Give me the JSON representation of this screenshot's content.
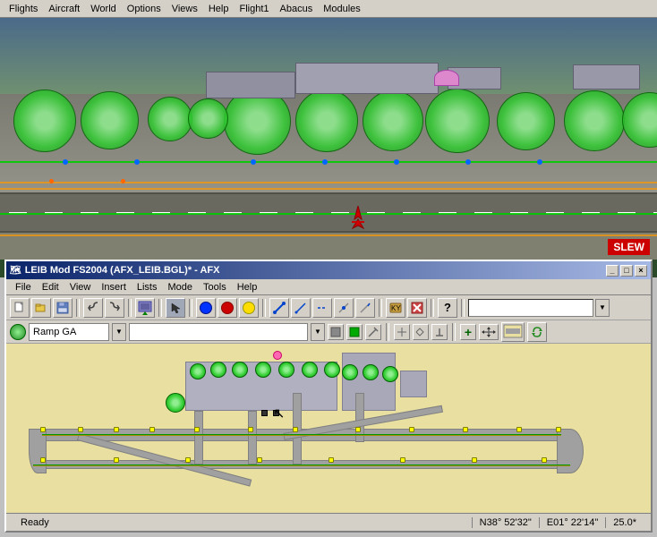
{
  "top_menu": {
    "items": [
      "Flights",
      "Aircraft",
      "World",
      "Options",
      "Views",
      "Help",
      "Flight1",
      "Abacus",
      "Modules"
    ]
  },
  "slew_badge": "SLEW",
  "afx_window": {
    "title": "LEIB Mod FS2004 (AFX_LEIB.BGL)* - AFX",
    "title_buttons": [
      "_",
      "□",
      "×"
    ],
    "menu_items": [
      "File",
      "Edit",
      "View",
      "Insert",
      "Lists",
      "Mode",
      "Tools",
      "Help"
    ],
    "toolbar1": {
      "buttons": [
        "new",
        "open",
        "save",
        "separator",
        "undo",
        "redo",
        "separator",
        "import",
        "separator",
        "cursor",
        "separator",
        "dot_blue",
        "dot_red",
        "dot_yellow",
        "separator",
        "line1",
        "line2",
        "line3",
        "line4",
        "line5",
        "separator",
        "key_icon",
        "x_icon",
        "separator",
        "help"
      ]
    },
    "toolbar2": {
      "indicator": "green",
      "dropdown1": "Ramp GA",
      "dropdown2": "",
      "buttons": [
        "square_gray",
        "square_green",
        "toolbar_icon1",
        "separator",
        "draw_btns",
        "plus",
        "cross_arrow"
      ]
    }
  },
  "status_bar": {
    "ready": "Ready",
    "coords1": "N38° 52'32\"",
    "coords2": "E01° 22'14\"",
    "zoom": "25.0*"
  }
}
